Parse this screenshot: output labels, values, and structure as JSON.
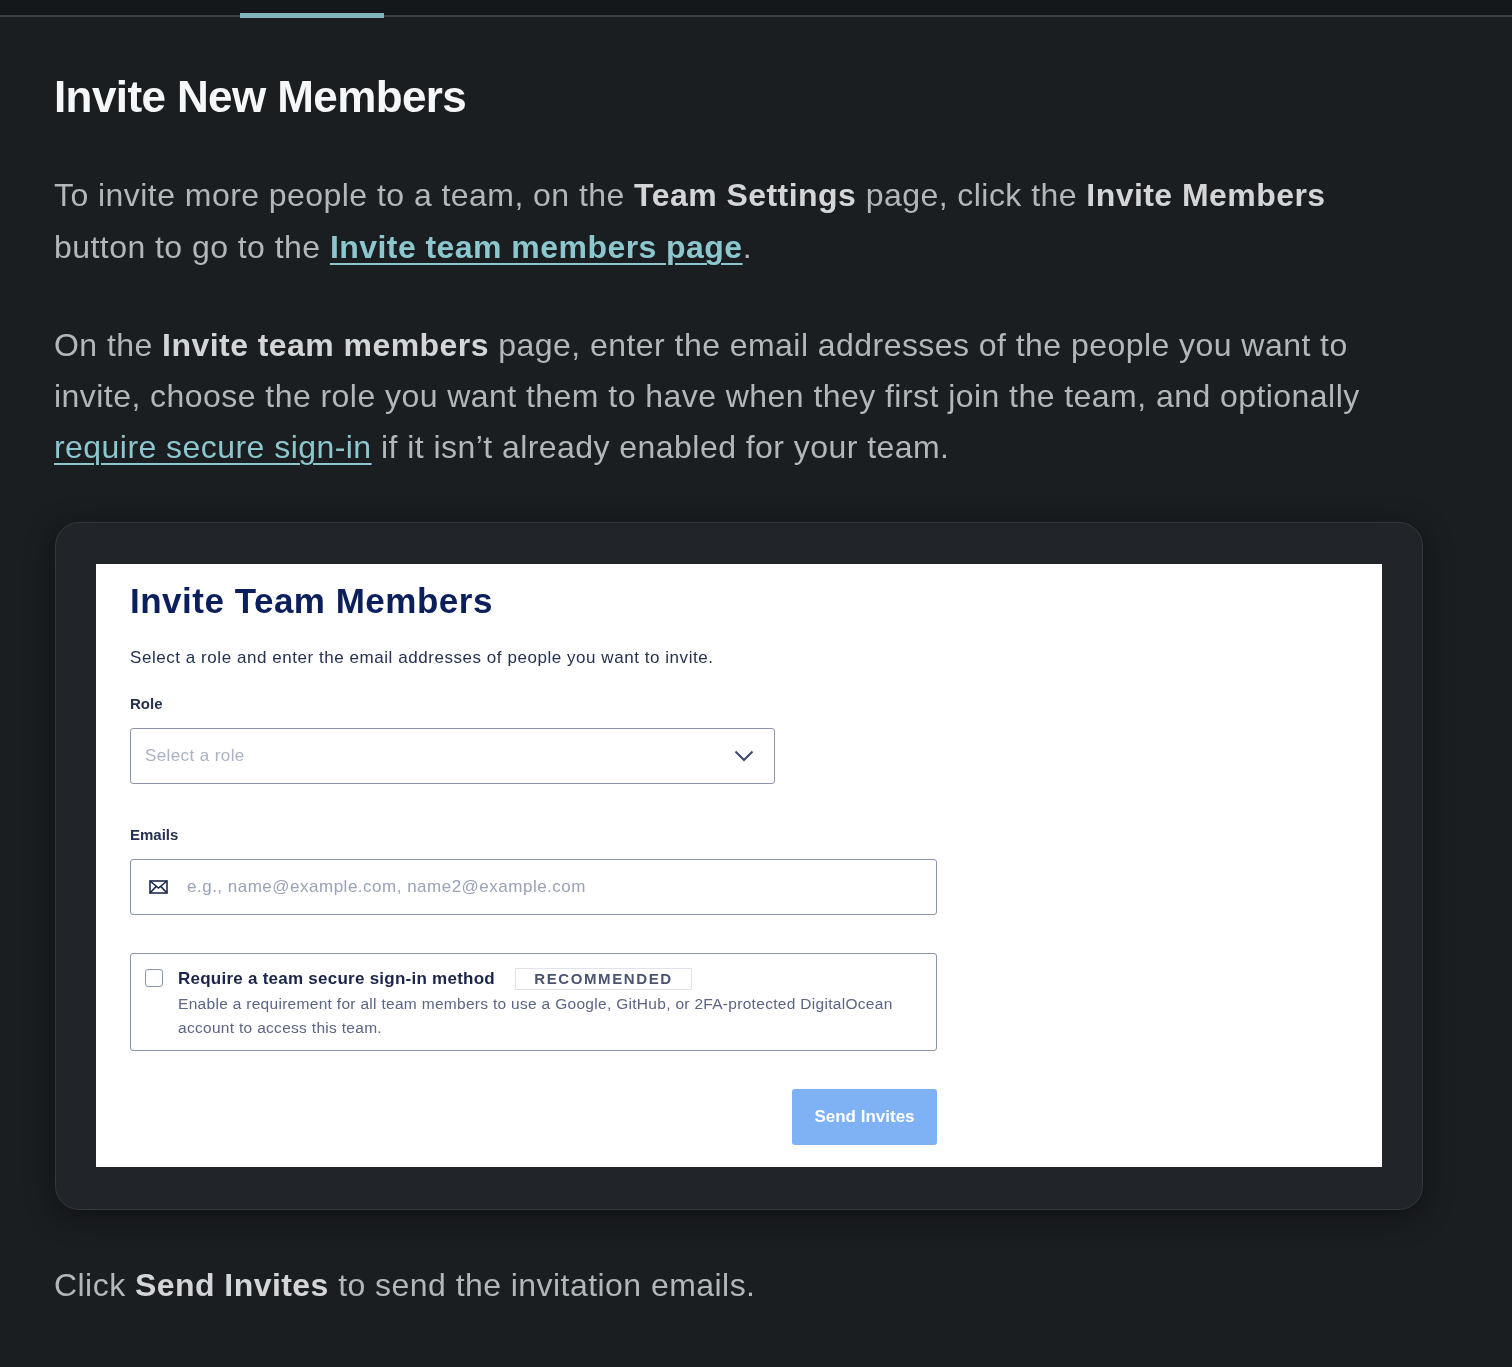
{
  "heading": "Invite New Members",
  "intro_paragraphs": [
    {
      "parts": [
        {
          "kind": "text",
          "text": "To invite more people to a team, on the **Team Settings** page, click the **Invite Members** button to go to the "
        },
        {
          "kind": "link",
          "text": "Invite team members page",
          "strong": true
        },
        {
          "kind": "text",
          "text": "."
        }
      ]
    },
    {
      "parts": [
        {
          "kind": "text",
          "text": "On the **Invite team members** page, enter the email addresses of the people you want to invite, choose the role you want them to have when they first join the team, and optionally "
        },
        {
          "kind": "link",
          "text": "require secure sign-in",
          "strong": false
        },
        {
          "kind": "text",
          "text": " if it isn’t already enabled for your team."
        }
      ]
    }
  ],
  "screenshot": {
    "title": "Invite Team Members",
    "subtitle": "Select a role and enter the email addresses of people you want to invite.",
    "role_field": {
      "label": "Role",
      "placeholder": "Select a role"
    },
    "emails_field": {
      "label": "Emails",
      "placeholder": "e.g., name@example.com, name2@example.com"
    },
    "secure_sign_in": {
      "checked": false,
      "title": "Require a team secure sign-in method",
      "badge": "RECOMMENDED",
      "description": "Enable a requirement for all team members to use a Google, GitHub, or 2FA-protected DigitalOcean account to access this team."
    },
    "submit_button": {
      "label": "Send Invites",
      "disabled": true
    }
  },
  "closing_paragraph": {
    "parts": [
      {
        "kind": "text",
        "text": "Click **Send Invites** to send the invitation emails."
      }
    ]
  }
}
